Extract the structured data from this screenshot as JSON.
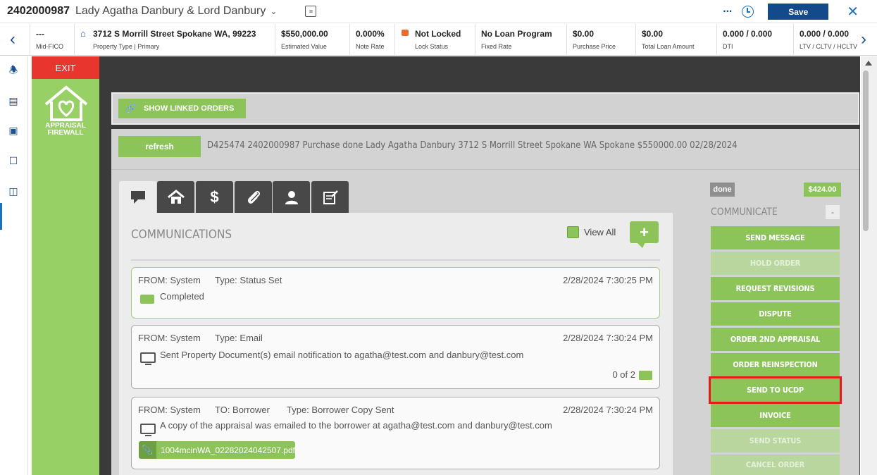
{
  "header": {
    "loan_number": "2402000987",
    "borrower_name": "Lady Agatha Danbury & Lord Danbury",
    "save_label": "Save"
  },
  "infobar": [
    {
      "value": "---",
      "label": "Mid-FICO"
    },
    {
      "value": "3712 S Morrill Street Spokane WA, 99223",
      "label": "Property Type | Primary"
    },
    {
      "value": "$550,000.00",
      "label": "Estimated Value"
    },
    {
      "value": "0.000%",
      "label": "Note Rate"
    },
    {
      "value": "Not Locked",
      "label": "Lock Status"
    },
    {
      "value": "No Loan Program",
      "label": "Fixed Rate"
    },
    {
      "value": "$0.00",
      "label": "Purchase Price"
    },
    {
      "value": "$0.00",
      "label": "Total Loan Amount"
    },
    {
      "value": "0.000 / 0.000",
      "label": "DTI"
    },
    {
      "value": "0.000 / 0.000",
      "label": "LTV / CLTV / HCLTV"
    }
  ],
  "sidepanel": {
    "exit_label": "EXIT",
    "logo_line1": "APPRAISAL",
    "logo_line2": "FIREWALL"
  },
  "toolbar": {
    "show_linked_label": "SHOW LINKED ORDERS",
    "refresh_label": "refresh"
  },
  "order_summary": "D425474  2402000987  Purchase  done  Lady Agatha  Danbury  3712 S Morrill Street  Spokane  WA  Spokane  $550000.00  02/28/2024",
  "communications": {
    "title": "COMMUNICATIONS",
    "view_all_label": "View All",
    "add_label": "+",
    "messages": [
      {
        "from": "FROM: System",
        "to": "",
        "type": "Type: Status Set",
        "date": "2/28/2024 7:30:25 PM",
        "body": "Completed"
      },
      {
        "from": "FROM: System",
        "to": "",
        "type": "Type: Email",
        "date": "2/28/2024 7:30:24 PM",
        "body": "Sent Property Document(s) email notification to agatha@test.com and danbury@test.com",
        "count": "0 of 2"
      },
      {
        "from": "FROM: System",
        "to": "TO: Borrower",
        "type": "Type: Borrower Copy Sent",
        "date": "2/28/2024 7:30:24 PM",
        "body": "A copy of the appraisal was emailed to the borrower at agatha@test.com and danbury@test.com",
        "attachment": "1004mcinWA_02282024042507.pdf"
      }
    ]
  },
  "actions": {
    "status_badge": "done",
    "price_badge": "$424.00",
    "section_title": "COMMUNICATE",
    "collapse_label": "-",
    "buttons": [
      {
        "label": "SEND MESSAGE",
        "enabled": true
      },
      {
        "label": "HOLD ORDER",
        "enabled": false
      },
      {
        "label": "REQUEST REVISIONS",
        "enabled": true
      },
      {
        "label": "DISPUTE",
        "enabled": true
      },
      {
        "label": "ORDER 2ND APPRAISAL",
        "enabled": true
      },
      {
        "label": "ORDER REINSPECTION",
        "enabled": true
      },
      {
        "label": "SEND TO UCDP",
        "enabled": true
      },
      {
        "label": "INVOICE",
        "enabled": true
      },
      {
        "label": "SEND STATUS",
        "enabled": false
      },
      {
        "label": "CANCEL ORDER",
        "enabled": false
      }
    ]
  },
  "colors": {
    "accent_green": "#8cc45a",
    "exit_red": "#e8362f",
    "primary_blue": "#154a8a",
    "highlight_red": "#e8191a"
  }
}
